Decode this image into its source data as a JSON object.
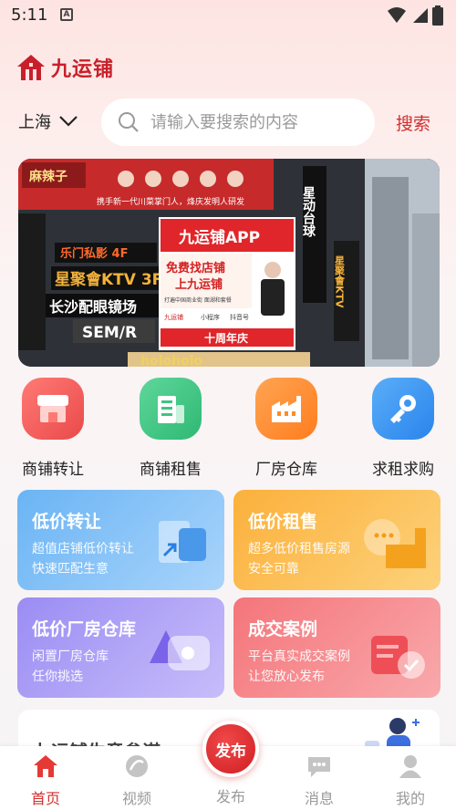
{
  "status_bar": {
    "time": "5:11",
    "notification_glyph": "A"
  },
  "header": {
    "app_name": "九运铺"
  },
  "search": {
    "city": "上海",
    "placeholder": "请输入要搜索的内容",
    "button_label": "搜索"
  },
  "banner": {
    "signs": {
      "sichuan_brand": "麻辣子",
      "sichuan_slogan": "携手新一代川菜掌门人，烽庆发明人研发",
      "leyou": "乐门私影 4F",
      "ktv": "星聚會KTV 3F",
      "eyewear": "长沙配眼镜场",
      "semr": "SEM/R",
      "app_title": "九运铺APP",
      "free_line1": "免费找店铺",
      "free_line2": "上九运铺",
      "ad_small": "打遍中国商业街 面湖和套餐",
      "ad_brand": "九运铺",
      "ad_mini": "小程序",
      "ad_douyin": "抖音号",
      "anniversary": "十周年庆",
      "tower1": "星动台球",
      "tower2": "星聚會KTV",
      "bottom": "holoholo"
    }
  },
  "quick_menu": [
    {
      "label": "商铺转让",
      "icon": "store-icon",
      "color": "#f0605c"
    },
    {
      "label": "商铺租售",
      "icon": "building-icon",
      "color": "#35c47f"
    },
    {
      "label": "厂房仓库",
      "icon": "factory-icon",
      "color": "#ff8a2a"
    },
    {
      "label": "求租求购",
      "icon": "key-icon",
      "color": "#2f8ff0"
    }
  ],
  "cards": [
    {
      "title": "低价转让",
      "subtitle_1": "超值店铺低价转让",
      "subtitle_2": "快速匹配生意",
      "color_from": "#6ab4f4",
      "color_to": "#a9d4fb"
    },
    {
      "title": "低价租售",
      "subtitle_1": "超多低价租售房源",
      "subtitle_2": "安全可靠",
      "color_from": "#fbb03b",
      "color_to": "#fdd27b"
    },
    {
      "title": "低价厂房仓库",
      "subtitle_1": "闲置厂房仓库",
      "subtitle_2": "任你挑选",
      "color_from": "#9b8cf3",
      "color_to": "#c7bdfa"
    },
    {
      "title": "成交案例",
      "subtitle_1": "平台真实成交案例",
      "subtitle_2": "让您放心发布",
      "color_from": "#f4757a",
      "color_to": "#f9a9ac"
    }
  ],
  "article": {
    "title": "九运铺生意参谋"
  },
  "tab_bar": {
    "home": "首页",
    "video": "视频",
    "publish_button": "发布",
    "publish": "发布",
    "messages": "消息",
    "mine": "我的"
  },
  "colors": {
    "brand_red": "#d32f2f",
    "tab_active": "#d32f2f",
    "tab_inactive": "#9a9a9a"
  }
}
